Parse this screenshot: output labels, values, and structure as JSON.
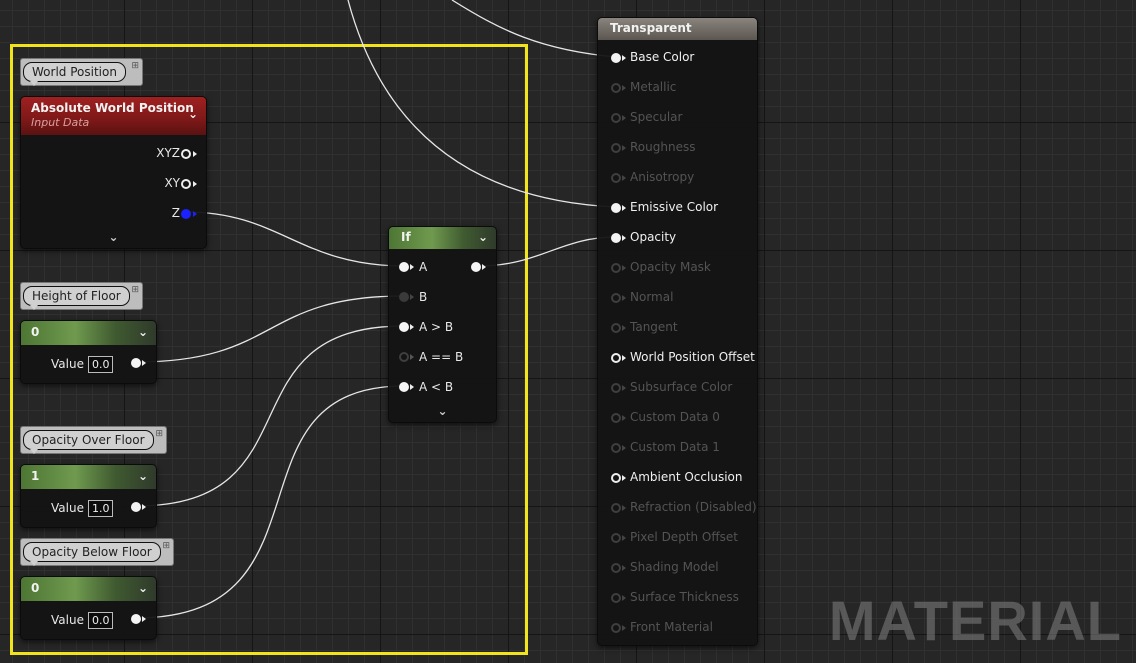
{
  "comments": {
    "world_position": "World Position",
    "height_of_floor": "Height of Floor",
    "opacity_over_floor": "Opacity Over Floor",
    "opacity_below_floor": "Opacity Below Floor"
  },
  "absolute_world_position": {
    "title": "Absolute World Position",
    "subtitle": "Input Data",
    "outputs": [
      "XYZ",
      "XY",
      "Z"
    ]
  },
  "height_floor_node": {
    "title": "0",
    "value_label": "Value",
    "value": "0.0"
  },
  "opacity_over_node": {
    "title": "1",
    "value_label": "Value",
    "value": "1.0"
  },
  "opacity_below_node": {
    "title": "0",
    "value_label": "Value",
    "value": "0.0"
  },
  "if_node": {
    "title": "If",
    "inputs": [
      "A",
      "B",
      "A > B",
      "A == B",
      "A < B"
    ]
  },
  "material_node": {
    "title": "Transparent",
    "inputs": [
      {
        "label": "Base Color",
        "state": "active-solid"
      },
      {
        "label": "Metallic",
        "state": "inactive"
      },
      {
        "label": "Specular",
        "state": "inactive"
      },
      {
        "label": "Roughness",
        "state": "inactive"
      },
      {
        "label": "Anisotropy",
        "state": "inactive"
      },
      {
        "label": "Emissive Color",
        "state": "active-solid"
      },
      {
        "label": "Opacity",
        "state": "active-solid"
      },
      {
        "label": "Opacity Mask",
        "state": "inactive"
      },
      {
        "label": "Normal",
        "state": "inactive"
      },
      {
        "label": "Tangent",
        "state": "inactive"
      },
      {
        "label": "World Position Offset",
        "state": "active-hollow"
      },
      {
        "label": "Subsurface Color",
        "state": "inactive"
      },
      {
        "label": "Custom Data 0",
        "state": "inactive"
      },
      {
        "label": "Custom Data 1",
        "state": "inactive"
      },
      {
        "label": "Ambient Occlusion",
        "state": "active-hollow"
      },
      {
        "label": "Refraction (Disabled)",
        "state": "inactive"
      },
      {
        "label": "Pixel Depth Offset",
        "state": "inactive"
      },
      {
        "label": "Shading Model",
        "state": "inactive"
      },
      {
        "label": "Surface Thickness",
        "state": "inactive"
      },
      {
        "label": "Front Material",
        "state": "inactive"
      }
    ]
  },
  "watermark": "MATERIAL",
  "colors": {
    "selection": "#f2e41c",
    "constant_header": "#5f8a42",
    "input_header": "#8e1c1c",
    "material_header": "#7a746d",
    "z_pin": "#1a22ff"
  }
}
